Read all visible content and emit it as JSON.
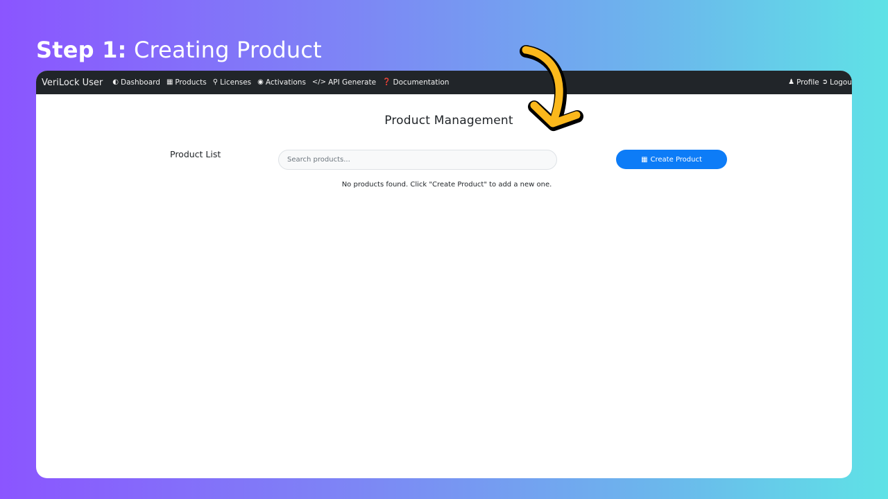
{
  "step": {
    "bold": "Step 1:",
    "text": "Creating Product"
  },
  "navbar": {
    "brand": "VeriLock User",
    "items": [
      {
        "label": "Dashboard",
        "icon": "dashboard-icon"
      },
      {
        "label": "Products",
        "icon": "box-icon"
      },
      {
        "label": "Licenses",
        "icon": "key-icon"
      },
      {
        "label": "Activations",
        "icon": "toggle-icon"
      },
      {
        "label": "API Generate",
        "icon": "code-icon"
      },
      {
        "label": "Documentation",
        "icon": "question-icon"
      }
    ],
    "profile": "Profile",
    "logout": "Logou"
  },
  "main": {
    "title": "Product Management",
    "list_label": "Product List",
    "search_placeholder": "Search products...",
    "create_button": "Create Product",
    "empty_message": "No products found. Click \"Create Product\" to add a new one."
  },
  "colors": {
    "navbar": "#212529",
    "primary_button": "#0d7cf7",
    "arrow": "#fbb81c"
  }
}
